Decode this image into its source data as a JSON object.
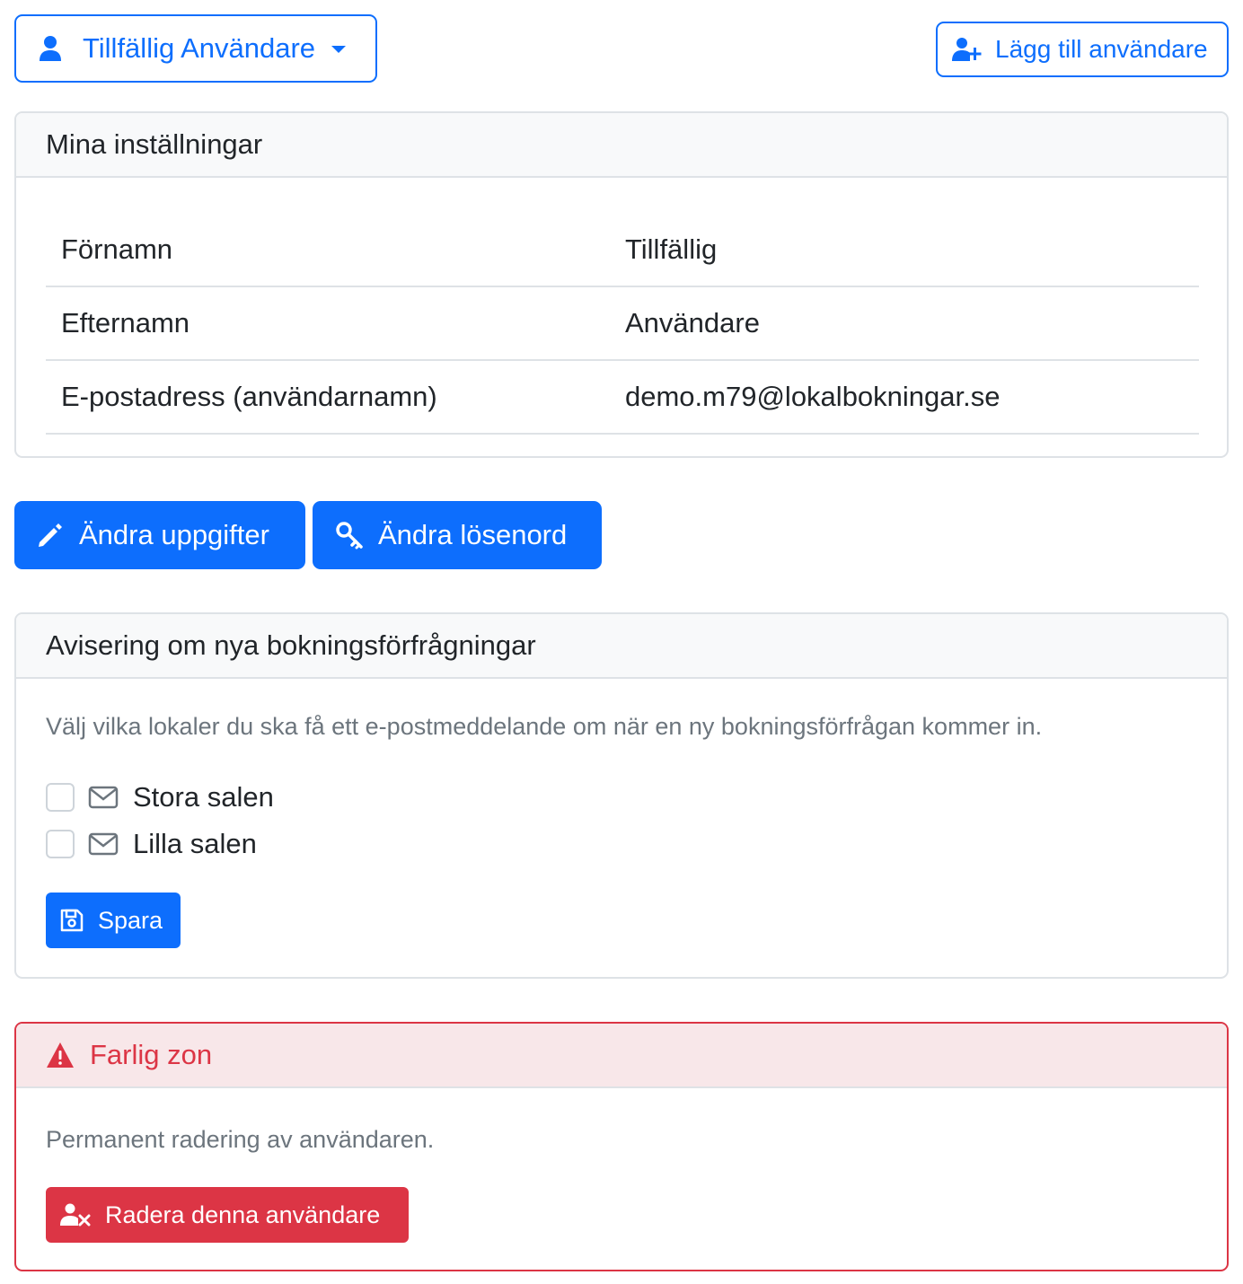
{
  "topbar": {
    "user_dropdown_label": "Tillfällig Användare",
    "add_user_label": "Lägg till användare"
  },
  "settings": {
    "title": "Mina inställningar",
    "rows": [
      {
        "label": "Förnamn",
        "value": "Tillfällig"
      },
      {
        "label": "Efternamn",
        "value": "Användare"
      },
      {
        "label": "E-postadress (användarnamn)",
        "value": "demo.m79@lokalbokningar.se"
      }
    ]
  },
  "actions": {
    "edit_label": "Ändra uppgifter",
    "password_label": "Ändra lösenord"
  },
  "notifications": {
    "title": "Avisering om nya bokningsförfrågningar",
    "description": "Välj vilka lokaler du ska få ett e-postmeddelande om när en ny bokningsförfrågan kommer in.",
    "venues": [
      {
        "label": "Stora salen",
        "checked": false
      },
      {
        "label": "Lilla salen",
        "checked": false
      }
    ],
    "save_label": "Spara"
  },
  "danger": {
    "title": "Farlig zon",
    "description": "Permanent radering av användaren.",
    "delete_label": "Radera denna användare"
  },
  "colors": {
    "primary": "#0d6efd",
    "danger": "#dc3545",
    "muted": "#6c757d",
    "border": "#dee2e6"
  },
  "icons": [
    "user-icon",
    "caret-down-icon",
    "user-plus-icon",
    "pencil-icon",
    "key-icon",
    "envelope-icon",
    "save-icon",
    "warning-icon",
    "user-delete-icon"
  ]
}
